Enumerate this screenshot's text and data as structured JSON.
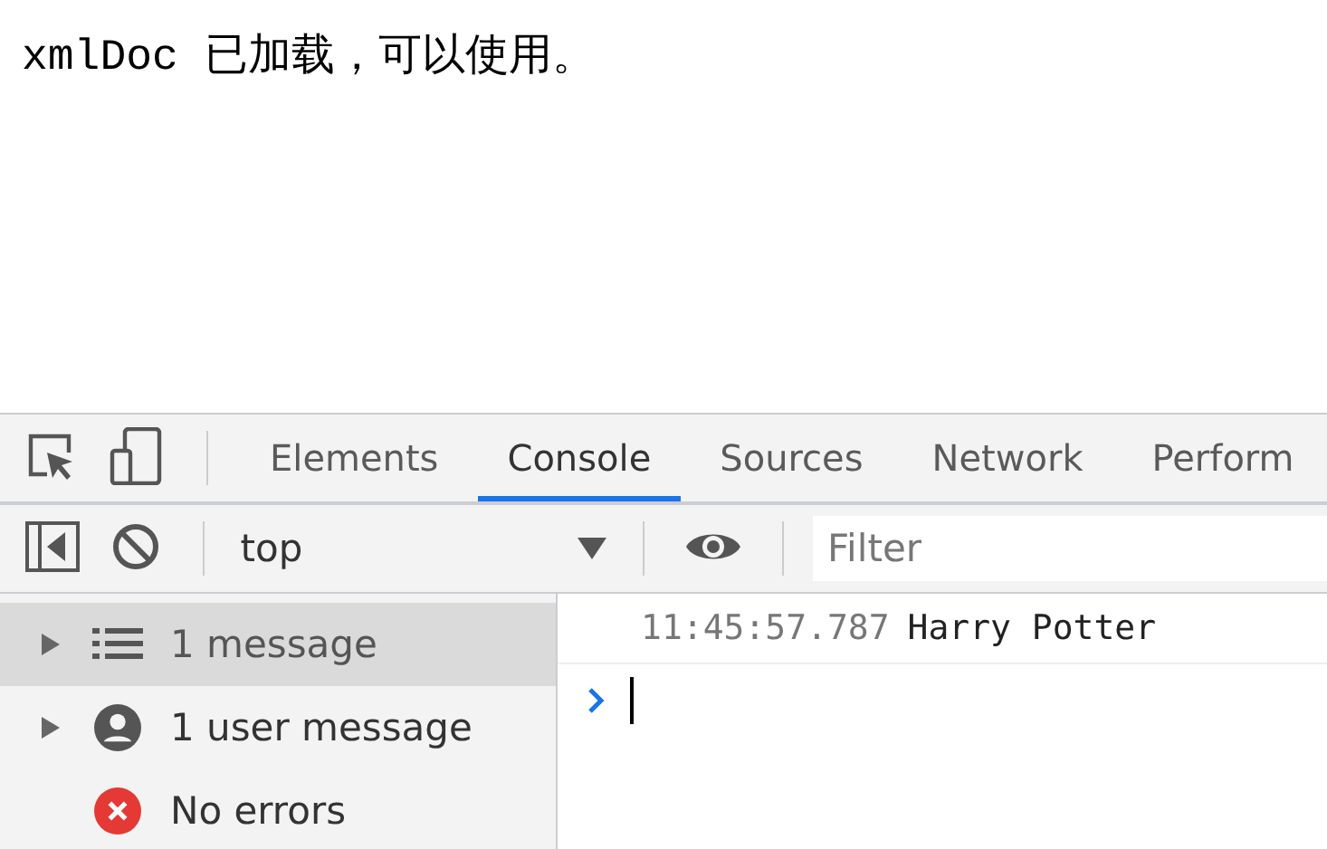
{
  "page": {
    "text": "xmlDoc 已加载，可以使用。"
  },
  "devtools": {
    "tabs": [
      {
        "label": "Elements",
        "selected": false
      },
      {
        "label": "Console",
        "selected": true
      },
      {
        "label": "Sources",
        "selected": false
      },
      {
        "label": "Network",
        "selected": false
      },
      {
        "label": "Perform",
        "selected": false
      }
    ],
    "toolbar": {
      "context": "top",
      "filter": {
        "placeholder": "Filter"
      }
    },
    "sidebar": {
      "items": [
        {
          "kind": "list",
          "label": "1 message",
          "selected": true
        },
        {
          "kind": "user",
          "label": "1 user message",
          "selected": false
        },
        {
          "kind": "error",
          "label": "No errors",
          "selected": false
        }
      ]
    },
    "console": {
      "entries": [
        {
          "timestamp": "11:45:57.787",
          "message": "Harry Potter"
        }
      ]
    }
  }
}
